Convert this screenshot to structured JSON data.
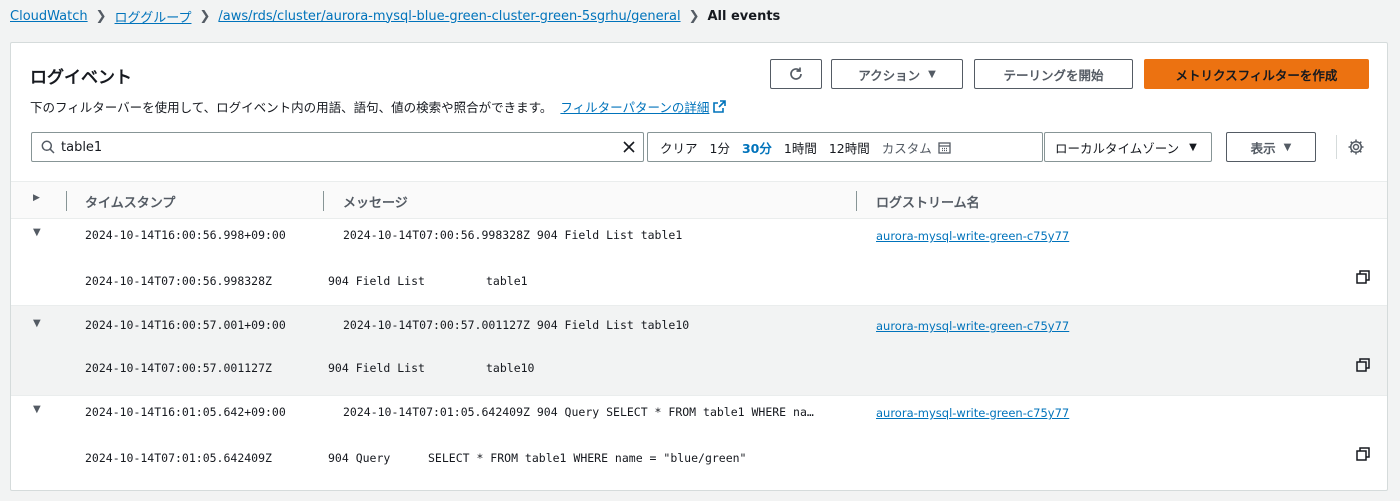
{
  "breadcrumb": {
    "items": [
      "CloudWatch",
      "ロググループ",
      "/aws/rds/cluster/aurora-mysql-blue-green-cluster-green-5sgrhu/general"
    ],
    "current": "All events"
  },
  "header": {
    "title": "ログイベント",
    "description": "下のフィルターバーを使用して、ログイベント内の用語、語句、値の検索や照合ができます。",
    "link": "フィルターパターンの詳細"
  },
  "toolbar": {
    "actions_label": "アクション",
    "tailing_label": "テーリングを開始",
    "create_filter_label": "メトリクスフィルターを作成"
  },
  "filter": {
    "search_value": "table1",
    "range_clear": "クリア",
    "range_1m": "1分",
    "range_30m": "30分",
    "range_1h": "1時間",
    "range_12h": "12時間",
    "range_custom": "カスタム",
    "active_range": "30分",
    "timezone": "ローカルタイムゾーン",
    "display_label": "表示"
  },
  "table": {
    "headers": [
      "タイムスタンプ",
      "メッセージ",
      "ログストリーム名"
    ],
    "rows": [
      {
        "timestamp": "2024-10-14T16:00:56.998+09:00",
        "message": "2024-10-14T07:00:56.998328Z 904 Field List table1",
        "stream": "aurora-mysql-write-green-c75y77",
        "detail_time": "2024-10-14T07:00:56.998328Z",
        "detail_thread": "904 Field List",
        "detail_arg": "table1"
      },
      {
        "timestamp": "2024-10-14T16:00:57.001+09:00",
        "message": "2024-10-14T07:00:57.001127Z 904 Field List table10",
        "stream": "aurora-mysql-write-green-c75y77",
        "detail_time": "2024-10-14T07:00:57.001127Z",
        "detail_thread": "904 Field List",
        "detail_arg": "table10"
      },
      {
        "timestamp": "2024-10-14T16:01:05.642+09:00",
        "message": "2024-10-14T07:01:05.642409Z 904 Query SELECT * FROM table1 WHERE na…",
        "stream": "aurora-mysql-write-green-c75y77",
        "detail_time": "2024-10-14T07:01:05.642409Z",
        "detail_thread": "904 Query",
        "detail_arg": "SELECT * FROM table1 WHERE name = \"blue/green\""
      }
    ]
  },
  "icons": {
    "refresh": "refresh-icon",
    "search": "search-icon",
    "clear": "close-icon",
    "calendar": "calendar-icon",
    "settings": "gear-icon",
    "copy": "copy-icon",
    "external": "external-link-icon"
  },
  "colors": {
    "primary": "#ec7211",
    "link": "#0073bb",
    "selected_row": "#f2f3f3"
  }
}
